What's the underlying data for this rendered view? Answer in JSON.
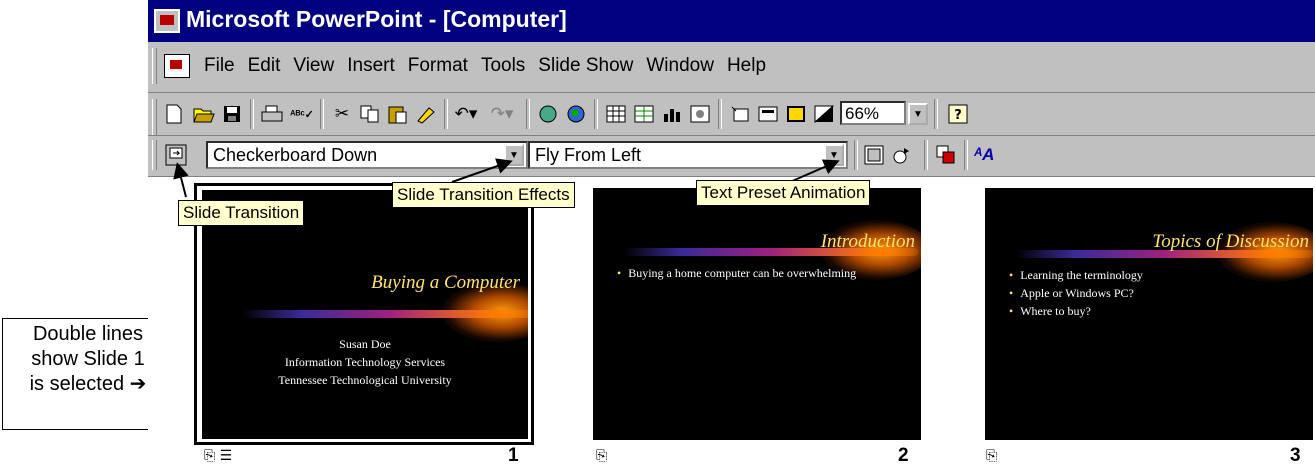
{
  "window": {
    "title": "Microsoft PowerPoint - [Computer]"
  },
  "menu": {
    "items": [
      "File",
      "Edit",
      "View",
      "Insert",
      "Format",
      "Tools",
      "Slide Show",
      "Window",
      "Help"
    ]
  },
  "toolbar": {
    "zoom": "66%",
    "icons": [
      "new-icon",
      "open-icon",
      "save-icon",
      "print-icon",
      "spelling-icon",
      "cut-icon",
      "copy-icon",
      "paste-icon",
      "format-painter-icon",
      "undo-icon",
      "redo-icon",
      "hyperlink-icon",
      "web-toolbar-icon",
      "insert-table-icon",
      "insert-excel-icon",
      "insert-chart-icon",
      "insert-clipart-icon",
      "new-slide-icon",
      "slide-layout-icon",
      "apply-design-icon",
      "grayscale-icon",
      "help-icon"
    ]
  },
  "animation_bar": {
    "transition_effect": "Checkerboard Down",
    "text_animation": "Fly From Left"
  },
  "callouts": {
    "slide_transition": "Slide Transition",
    "transition_effects": "Slide Transition Effects",
    "text_preset": "Text Preset Animation"
  },
  "note": {
    "line1": "Double lines",
    "line2": "show Slide 1",
    "line3": "is selected ➔"
  },
  "slides": [
    {
      "number": "1",
      "title": "Buying a Computer",
      "lines": [
        "Susan Doe",
        "Information Technology Services",
        "Tennessee Technological University"
      ],
      "selected": true
    },
    {
      "number": "2",
      "title": "Introduction",
      "bullets": [
        "Buying a home computer can be overwhelming"
      ]
    },
    {
      "number": "3",
      "title": "Topics of Discussion",
      "bullets": [
        "Learning the terminology",
        "Apple or Windows PC?",
        "Where to buy?"
      ]
    }
  ],
  "colors": {
    "titlebar": "#000080",
    "chrome": "#c0c0c0",
    "slide_title": "#ffe36b",
    "callout_bg": "#ffffcc"
  }
}
